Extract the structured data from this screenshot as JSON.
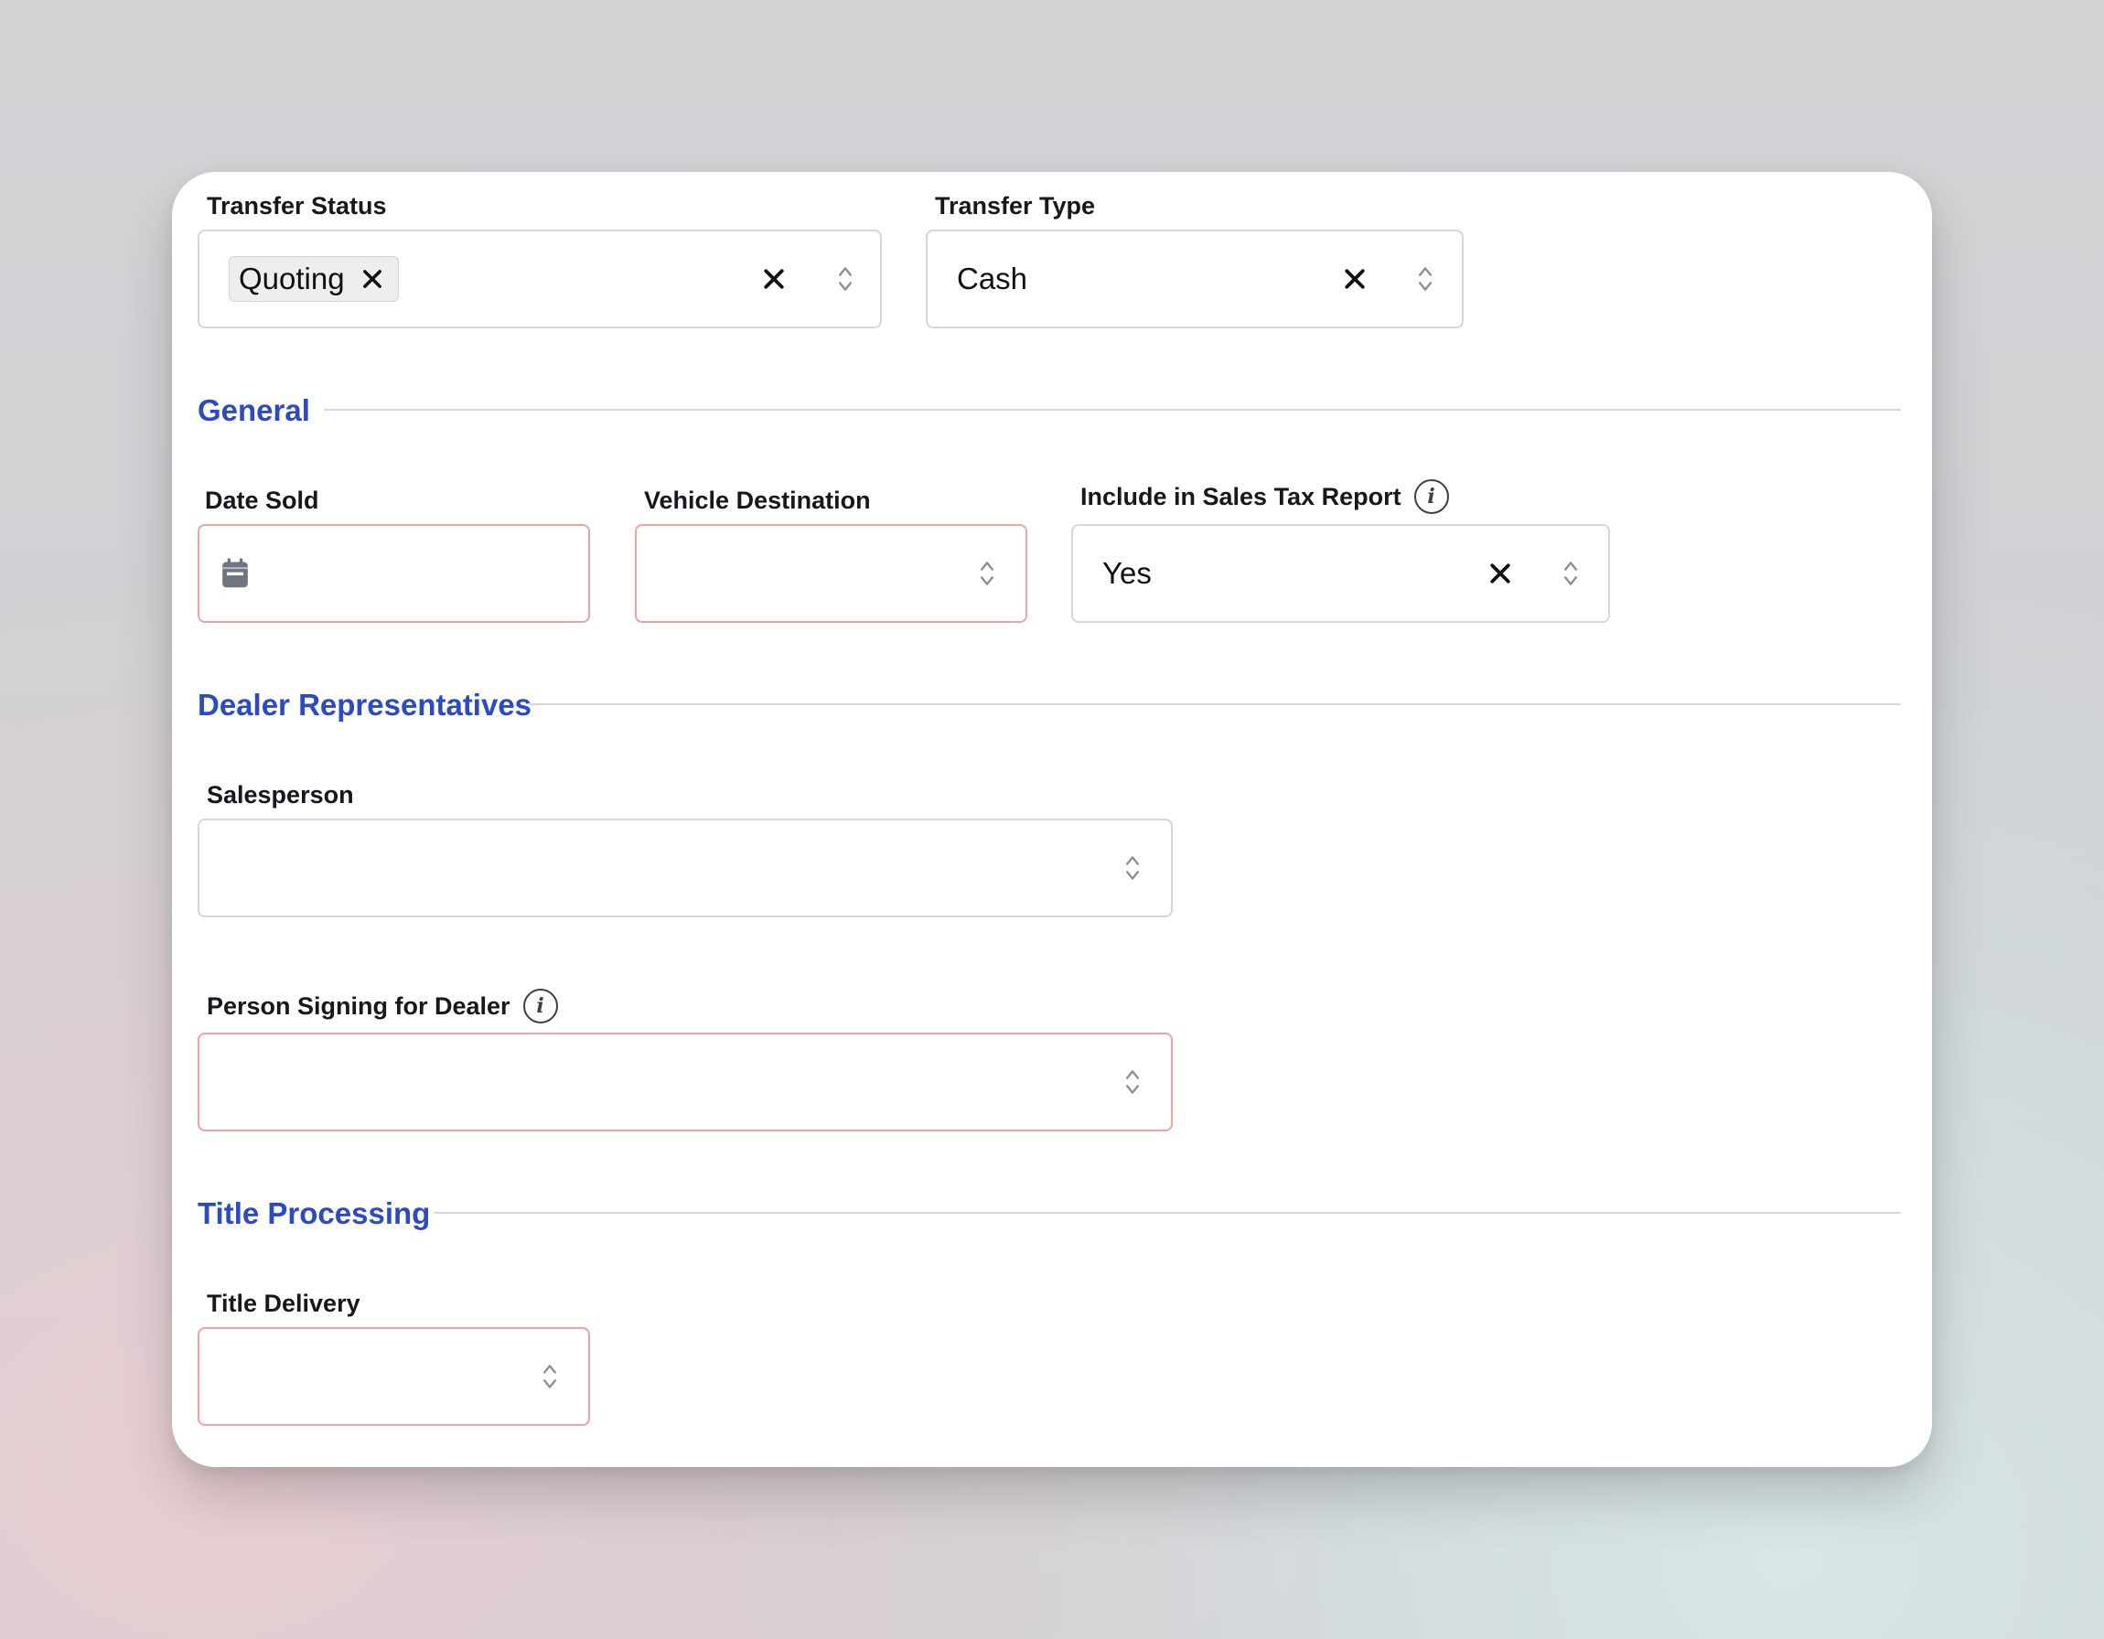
{
  "transfer_status": {
    "label": "Transfer Status",
    "chip": "Quoting"
  },
  "transfer_type": {
    "label": "Transfer Type",
    "value": "Cash"
  },
  "sections": {
    "general": "General",
    "dealer_reps": "Dealer Representatives",
    "title_processing": "Title Processing"
  },
  "date_sold": {
    "label": "Date Sold"
  },
  "vehicle_destination": {
    "label": "Vehicle Destination"
  },
  "sales_tax": {
    "label": "Include in Sales Tax Report",
    "value": "Yes",
    "info": "i"
  },
  "salesperson": {
    "label": "Salesperson"
  },
  "person_signing": {
    "label": "Person Signing for Dealer",
    "info": "i"
  },
  "title_delivery": {
    "label": "Title Delivery"
  },
  "colors": {
    "accent": "#2b4acb",
    "error_border": "#f0a2a4",
    "border": "#d5d7db"
  }
}
